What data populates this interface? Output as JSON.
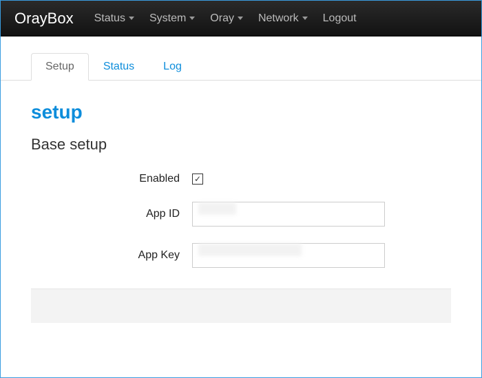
{
  "navbar": {
    "brand": "OrayBox",
    "items": [
      {
        "label": "Status",
        "hasDropdown": true
      },
      {
        "label": "System",
        "hasDropdown": true
      },
      {
        "label": "Oray",
        "hasDropdown": true
      },
      {
        "label": "Network",
        "hasDropdown": true
      },
      {
        "label": "Logout",
        "hasDropdown": false
      }
    ]
  },
  "tabs": [
    {
      "label": "Setup",
      "active": true
    },
    {
      "label": "Status",
      "active": false
    },
    {
      "label": "Log",
      "active": false
    }
  ],
  "page": {
    "title": "setup",
    "sectionTitle": "Base setup"
  },
  "form": {
    "enabled": {
      "label": "Enabled",
      "checked": true
    },
    "appId": {
      "label": "App ID",
      "value": ""
    },
    "appKey": {
      "label": "App Key",
      "value": ""
    }
  }
}
